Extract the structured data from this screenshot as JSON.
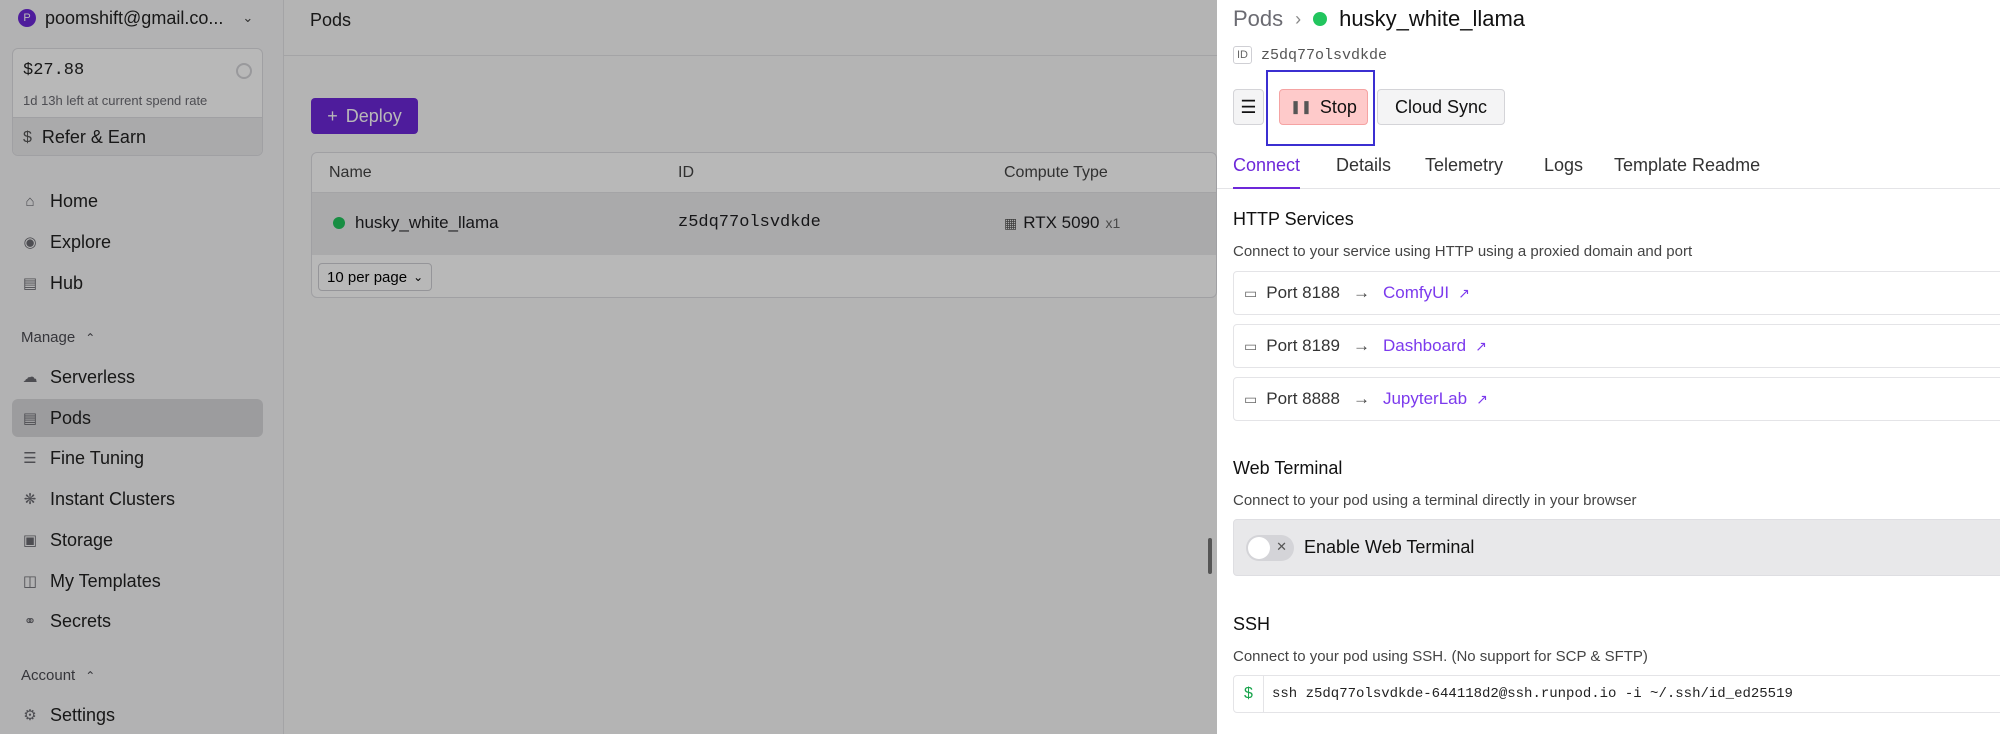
{
  "sidebar": {
    "account": {
      "initial": "P",
      "email": "poomshift@gmail.co..."
    },
    "balance": {
      "amount": "$27.88",
      "time_left": "1d 13h left at current spend rate",
      "refer_label": "Refer & Earn"
    },
    "nav": [
      {
        "label": "Home",
        "icon": "home-icon"
      },
      {
        "label": "Explore",
        "icon": "compass-icon"
      },
      {
        "label": "Hub",
        "icon": "hub-icon"
      }
    ],
    "manage_label": "Manage",
    "manage": [
      {
        "label": "Serverless",
        "icon": "cloud-icon"
      },
      {
        "label": "Pods",
        "icon": "pods-icon",
        "active": true
      },
      {
        "label": "Fine Tuning",
        "icon": "sliders-icon"
      },
      {
        "label": "Instant Clusters",
        "icon": "cluster-icon"
      },
      {
        "label": "Storage",
        "icon": "storage-icon"
      },
      {
        "label": "My Templates",
        "icon": "template-icon"
      },
      {
        "label": "Secrets",
        "icon": "key-icon"
      }
    ],
    "account_label": "Account",
    "account_items": [
      {
        "label": "Settings",
        "icon": "gear-icon"
      }
    ]
  },
  "main": {
    "title": "Pods",
    "deploy_label": "Deploy",
    "columns": [
      "Name",
      "ID",
      "Compute Type"
    ],
    "rows": [
      {
        "name": "husky_white_llama",
        "id": "z5dq77olsvdkde",
        "compute": "RTX 5090",
        "count": "x1"
      }
    ],
    "per_page": "10 per page"
  },
  "panel": {
    "breadcrumb_root": "Pods",
    "pod_name": "husky_white_llama",
    "id_tag": "ID",
    "pod_id": "z5dq77olsvdkde",
    "stop_label": "Stop",
    "cloud_sync_label": "Cloud Sync",
    "tabs": [
      "Connect",
      "Details",
      "Telemetry",
      "Logs",
      "Template Readme"
    ],
    "http": {
      "title": "HTTP Services",
      "desc": "Connect to your service using HTTP using a proxied domain and port",
      "ports": [
        {
          "port": "Port 8188",
          "service": "ComfyUI"
        },
        {
          "port": "Port 8189",
          "service": "Dashboard"
        },
        {
          "port": "Port 8888",
          "service": "JupyterLab"
        }
      ]
    },
    "web_terminal": {
      "title": "Web Terminal",
      "desc": "Connect to your pod using a terminal directly in your browser",
      "toggle_label": "Enable Web Terminal"
    },
    "ssh": {
      "title": "SSH",
      "desc": "Connect to your pod using SSH. (No support for SCP & SFTP)",
      "prompt": "$",
      "command": "ssh z5dq77olsvdkde-644118d2@ssh.runpod.io -i ~/.ssh/id_ed25519"
    }
  }
}
